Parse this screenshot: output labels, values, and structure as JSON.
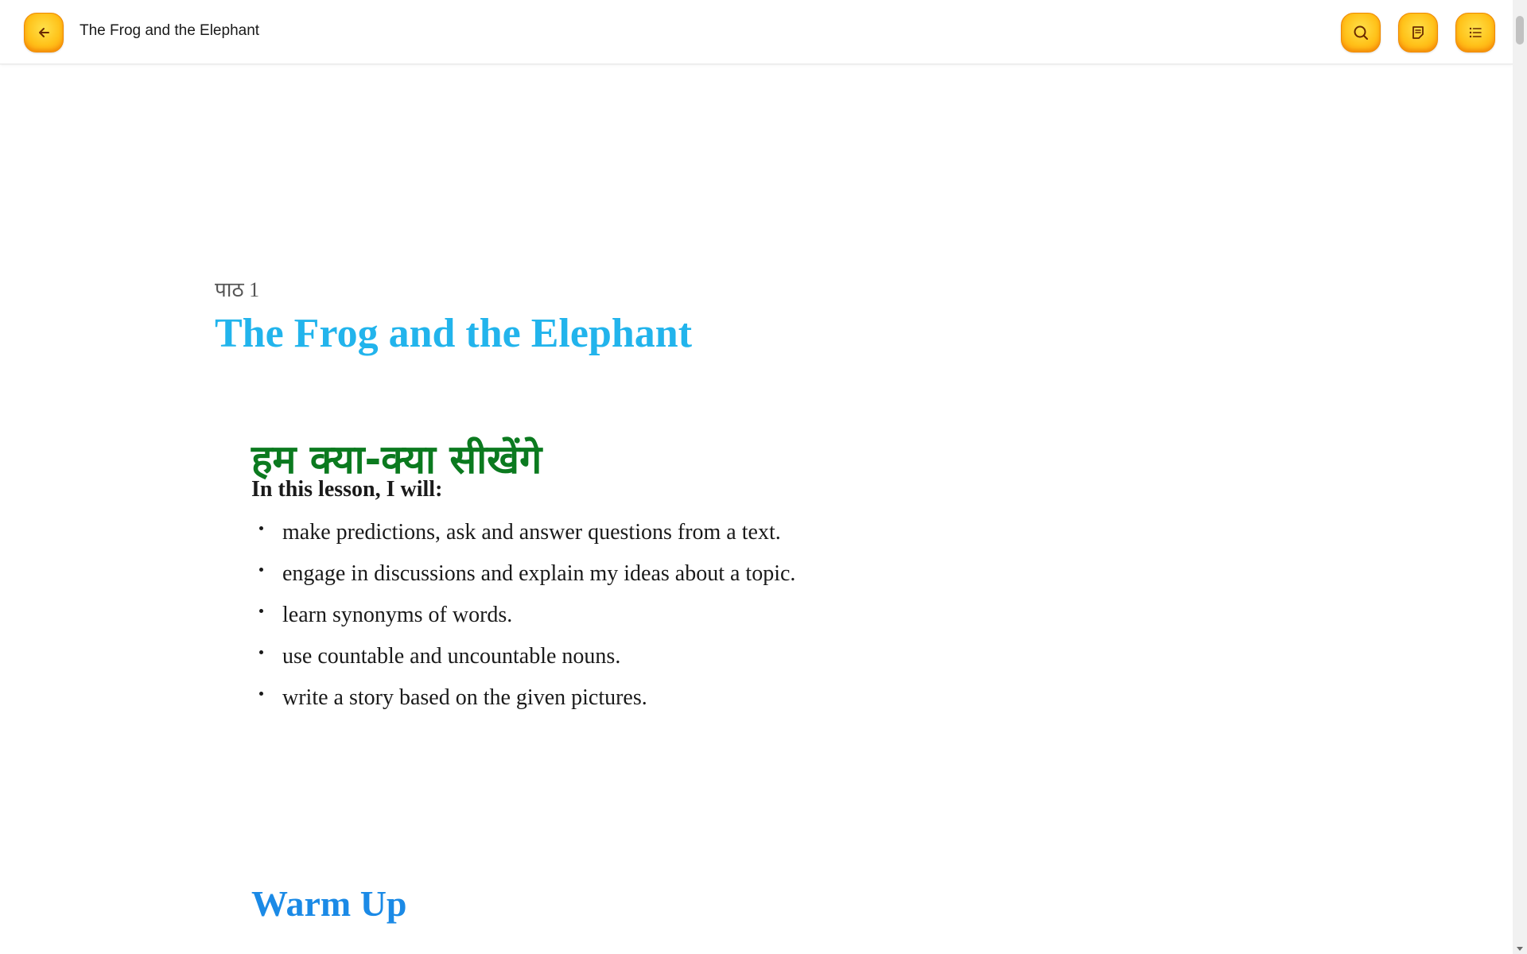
{
  "header": {
    "title": "The Frog and the Elephant",
    "back_icon": "arrow-left-icon",
    "search_icon": "search-icon",
    "notes_icon": "notes-icon",
    "toc_icon": "list-icon",
    "accent_color": "#ffc21a"
  },
  "lesson": {
    "label": "पाठ 1",
    "title": "The Frog and the Elephant"
  },
  "objectives": {
    "heading": "हम क्या-क्या सीखेंगे",
    "intro": "In this lesson, I will:",
    "items": [
      "make predictions, ask and answer questions from a text.",
      "engage in discussions and explain my ideas about a topic.",
      "learn synonyms of words.",
      "use countable and uncountable nouns.",
      "write a story based on the given pictures."
    ]
  },
  "next_section": {
    "heading": "Warm Up"
  },
  "colors": {
    "title_blue": "#22b4ec",
    "heading_green": "#0b7a1f",
    "warmup_blue": "#1b8ae6"
  }
}
